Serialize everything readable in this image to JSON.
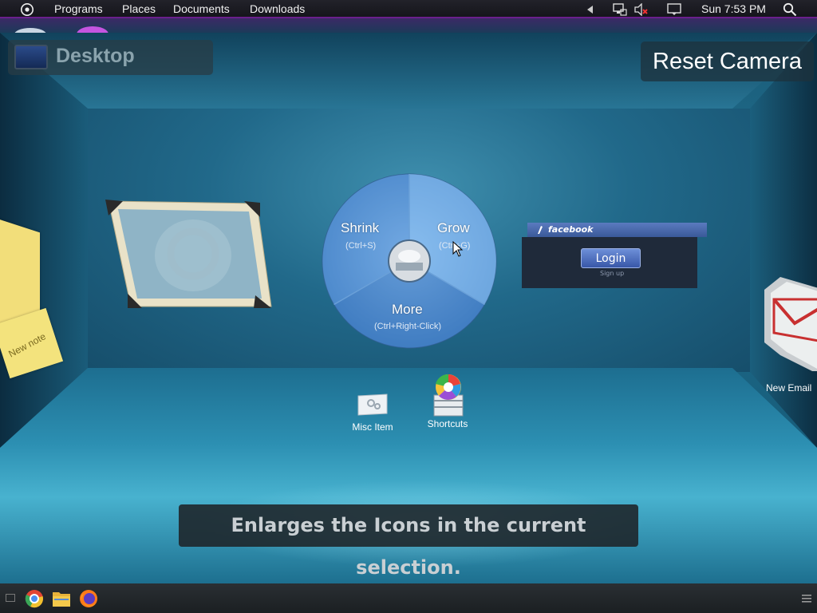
{
  "top_panel": {
    "menu": [
      {
        "label": "Programs"
      },
      {
        "label": "Places"
      },
      {
        "label": "Documents"
      },
      {
        "label": "Downloads"
      }
    ],
    "clock": "Sun 7:53 PM",
    "icons": [
      "ubuntu-logo-icon",
      "arrow-left-icon",
      "network-icon",
      "volume-muted-icon",
      "chat-icon",
      "search-icon"
    ]
  },
  "desktop": {
    "title": "Desktop",
    "reset_camera": "Reset Camera"
  },
  "pie_menu": {
    "shrink": "Shrink",
    "shrink_hint": "(Ctrl+S)",
    "grow": "Grow",
    "grow_hint": "(Ctrl+G)",
    "more": "More",
    "more_hint": "(Ctrl+Right-Click)"
  },
  "facebook": {
    "header": "facebook",
    "login": "Login",
    "signup": "Sign up"
  },
  "notes": {
    "new_note": "New note"
  },
  "items": {
    "misc": "Misc Item",
    "shortcuts": "Shortcuts",
    "new_email": "New Email"
  },
  "tooltip": "Enlarges the Icons in the current selection.",
  "colors": {
    "panel_border": "#6a1f8c",
    "pie_blue": "#4f8fd4",
    "fb_blue": "#3a5999"
  }
}
